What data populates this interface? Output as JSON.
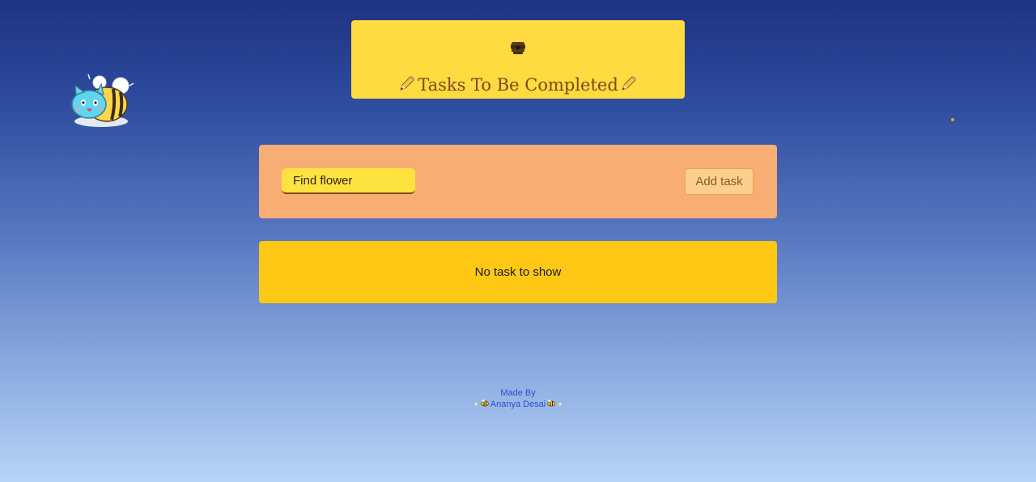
{
  "header": {
    "emoji_icon": "beehive-icon",
    "title": "Tasks To Be Completed",
    "title_icon": "pencil-icon"
  },
  "mascot": {
    "icon": "cat-bee-mascot-icon"
  },
  "form": {
    "input_value": "Find flower",
    "add_button_label": "Add task"
  },
  "task_list": {
    "empty_message": "No task to show"
  },
  "footer": {
    "made_by_label": "Made By",
    "author_name": "Ananya Desai"
  },
  "colors": {
    "header_bg": "#fedb3f",
    "form_bg": "#f8ad74",
    "list_bg": "#fec814",
    "input_bg": "#fee23f",
    "button_bg": "#fbd08f",
    "title_color": "#7a4a1c",
    "footer_text": "#2a4fd0"
  }
}
